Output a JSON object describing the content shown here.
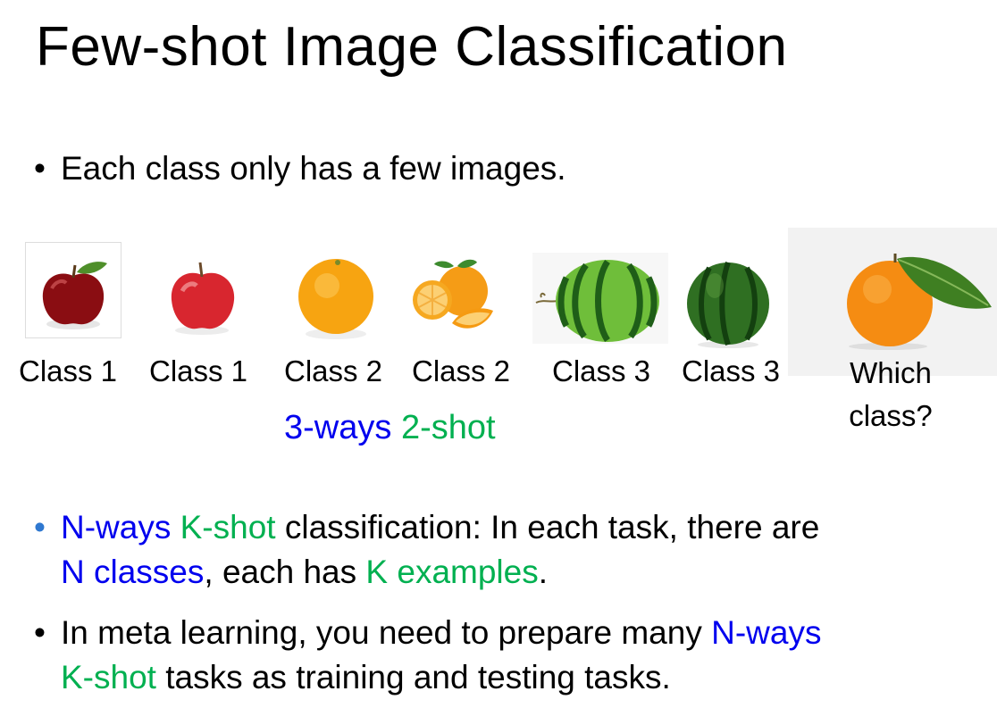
{
  "slide": {
    "title": "Few-shot Image Classification",
    "bullet1": "Each class only has a few images.",
    "bullet_symbol": "•",
    "support_set": [
      {
        "label": "Class 1",
        "icon": "red-apple-icon"
      },
      {
        "label": "Class 1",
        "icon": "red-apple-icon"
      },
      {
        "label": "Class 2",
        "icon": "orange-icon"
      },
      {
        "label": "Class 2",
        "icon": "sliced-orange-icon"
      },
      {
        "label": "Class 3",
        "icon": "watermelon-icon"
      },
      {
        "label": "Class 3",
        "icon": "watermelon-icon"
      }
    ],
    "query": {
      "line1": "Which",
      "line2": "class?",
      "icon": "tangerine-with-leaf-icon"
    },
    "setting": {
      "ways": "3-ways",
      "shot": "2-shot"
    },
    "bullet2": {
      "n_ways": "N-ways",
      "k_shot": "K-shot",
      "text_a": " classification: In each task, there are",
      "n_classes": "N classes",
      "text_b": ", each has ",
      "k_examples": "K examples",
      "text_c": "."
    },
    "bullet3": {
      "text_a": "In meta learning, you need to prepare many ",
      "n_ways": "N-ways",
      "k_shot": "K-shot",
      "text_b": " tasks as training and testing tasks."
    },
    "colors": {
      "blue": "#0000ee",
      "green": "#00b050",
      "bullet_blue": "#2f78d0"
    }
  }
}
